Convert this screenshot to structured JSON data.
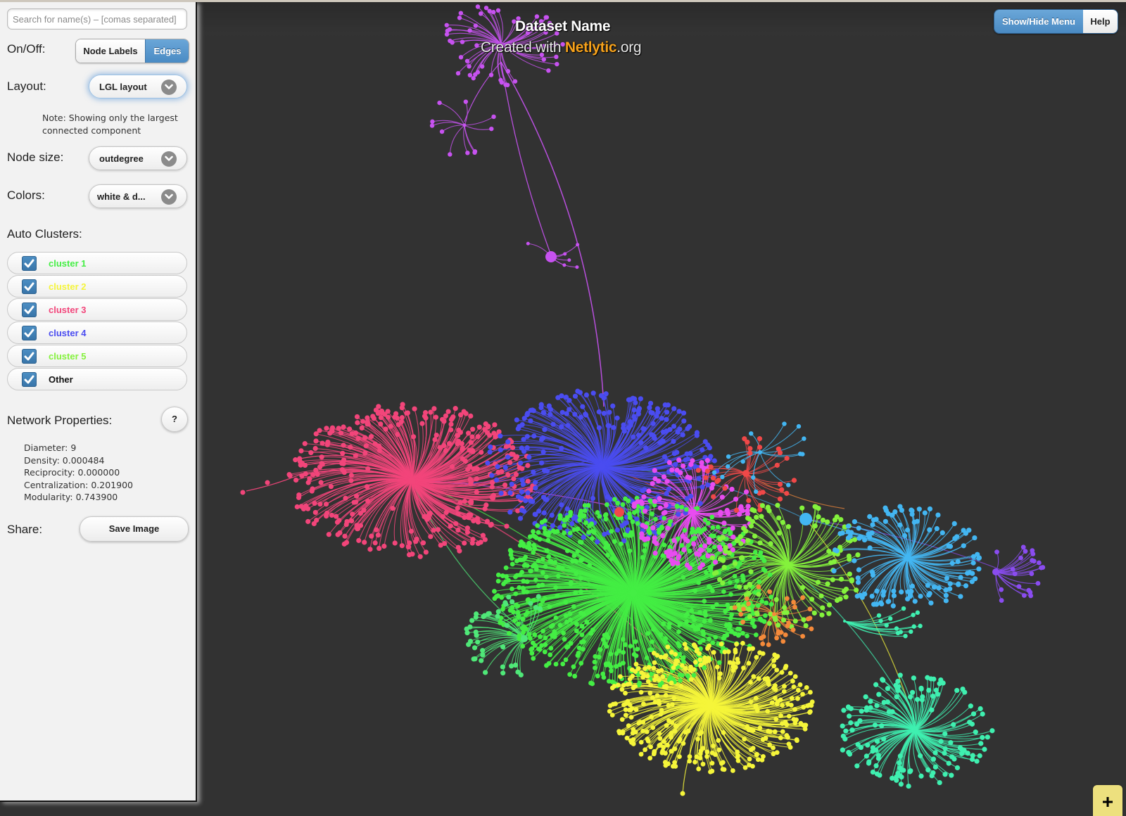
{
  "header": {
    "dataset_name": "Dataset Name",
    "created_prefix": "Created with ",
    "brand": "Netlytic",
    "brand_suffix": ".org"
  },
  "top_buttons": {
    "show_hide_menu": "Show/Hide Menu",
    "help": "Help"
  },
  "search": {
    "placeholder": "Search for name(s) – [comas separated]",
    "value": ""
  },
  "on_off": {
    "label": "On/Off:",
    "options": [
      {
        "label": "Node Labels",
        "active": false
      },
      {
        "label": "Edges",
        "active": true
      }
    ]
  },
  "layout": {
    "label": "Layout:",
    "selected": "LGL layout",
    "note": "Note: Showing only the largest connected component"
  },
  "node_size": {
    "label": "Node size:",
    "selected": "outdegree"
  },
  "colors": {
    "label": "Colors:",
    "selected": "white & d..."
  },
  "auto_clusters": {
    "label": "Auto Clusters:",
    "items": [
      {
        "label": "cluster 1",
        "color": "#44ee44",
        "checked": true
      },
      {
        "label": "cluster 2",
        "color": "#f5f53a",
        "checked": true
      },
      {
        "label": "cluster 3",
        "color": "#f2457a",
        "checked": true
      },
      {
        "label": "cluster 4",
        "color": "#4a4cf0",
        "checked": true
      },
      {
        "label": "cluster 5",
        "color": "#84f23c",
        "checked": true
      },
      {
        "label": "Other",
        "color": "#111111",
        "checked": true
      }
    ]
  },
  "network_properties": {
    "label": "Network Properties:",
    "help_label": "?",
    "lines": [
      "Diameter: 9",
      "Density: 0.000484",
      "Reciprocity: 0.000000",
      "Centralization: 0.201900",
      "Modularity: 0.743900"
    ]
  },
  "share": {
    "label": "Share:",
    "save_image": "Save Image"
  },
  "zoom_button": "+",
  "graph": {
    "background": "#323232",
    "clusters": [
      {
        "name": "cluster-3-pink",
        "color": "#f2457a"
      },
      {
        "name": "cluster-4-blue",
        "color": "#4a4cf0"
      },
      {
        "name": "cluster-1-green",
        "color": "#44ee44"
      },
      {
        "name": "cluster-2-yellow",
        "color": "#f5f53a"
      },
      {
        "name": "cluster-5-lime",
        "color": "#84f23c"
      },
      {
        "name": "cluster-magenta",
        "color": "#e84cf0"
      },
      {
        "name": "cluster-lightblue",
        "color": "#43b6f2"
      },
      {
        "name": "cluster-teal",
        "color": "#3ff0b0"
      },
      {
        "name": "cluster-seagreen",
        "color": "#4fe878"
      },
      {
        "name": "cluster-purple",
        "color": "#c752f0"
      },
      {
        "name": "cluster-violet",
        "color": "#8a4cf0"
      },
      {
        "name": "cluster-red",
        "color": "#f04848"
      },
      {
        "name": "cluster-orange",
        "color": "#f58a3a"
      }
    ]
  }
}
